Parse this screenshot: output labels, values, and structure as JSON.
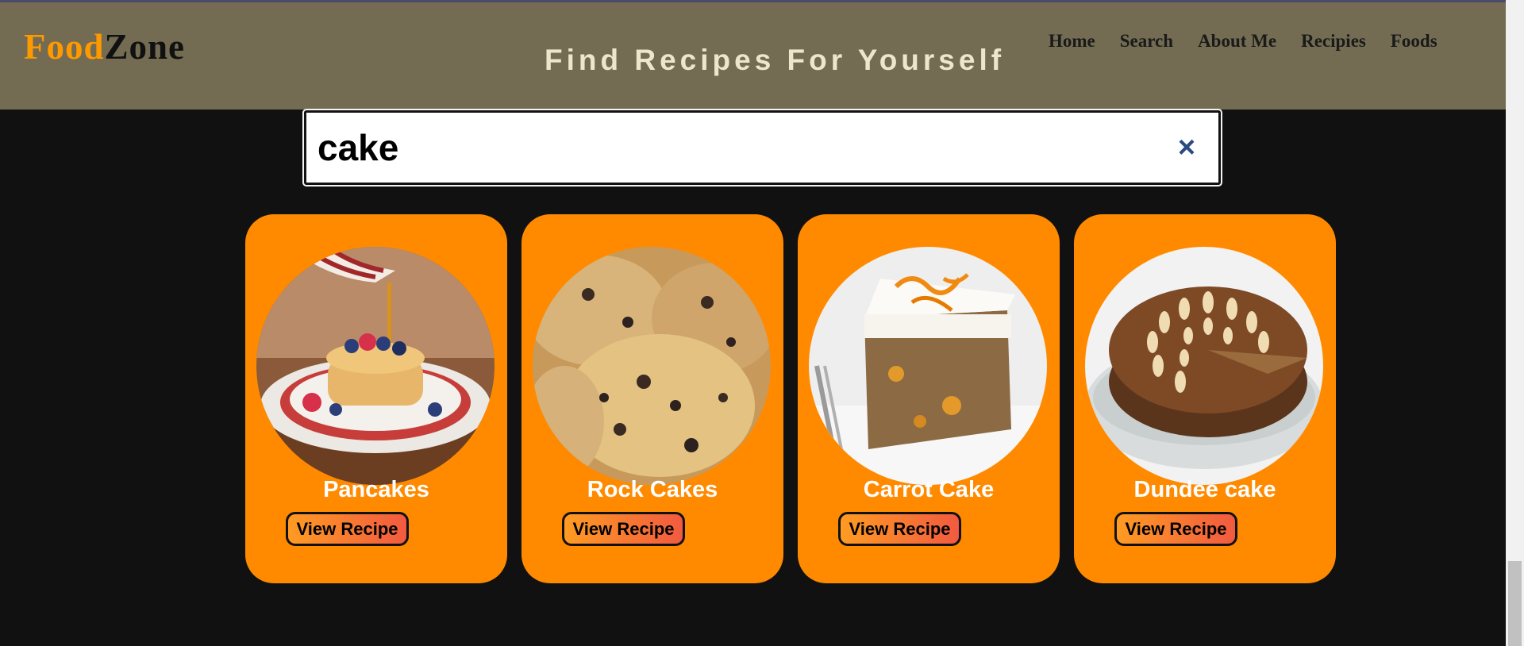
{
  "header": {
    "logo_part1": "Food",
    "logo_part2": "Zone",
    "tagline": "Find Recipes For Yourself",
    "nav": [
      "Home",
      "Search",
      "About Me",
      "Recipies",
      "Foods"
    ]
  },
  "search": {
    "value": "cake",
    "clear_icon": "×"
  },
  "results": [
    {
      "title": "Pancakes",
      "button": "View Recipe",
      "image": "pancakes-image"
    },
    {
      "title": "Rock Cakes",
      "button": "View Recipe",
      "image": "rock-cakes-image"
    },
    {
      "title": "Carrot Cake",
      "button": "View Recipe",
      "image": "carrot-cake-image"
    },
    {
      "title": "Dundee cake",
      "button": "View Recipe",
      "image": "dundee-cake-image"
    }
  ],
  "colors": {
    "header_bg": "#736c52",
    "page_bg": "#111111",
    "card_bg": "#ff8a00",
    "logo_accent": "#ff9900"
  }
}
